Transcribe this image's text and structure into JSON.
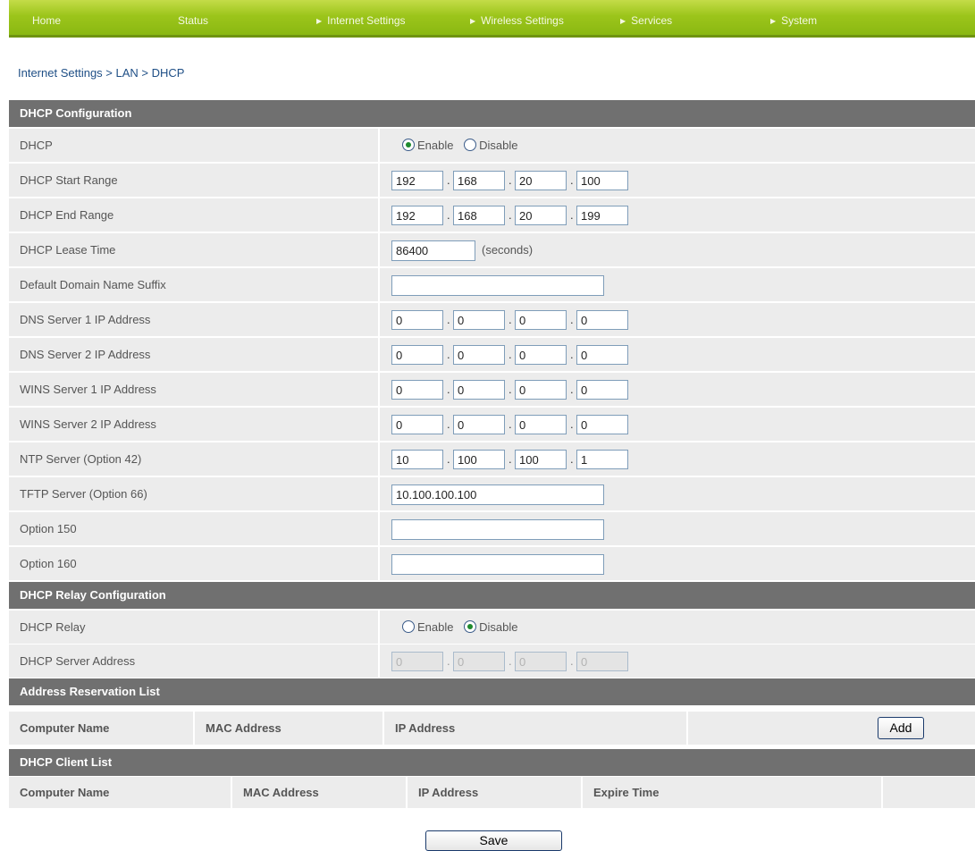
{
  "nav": {
    "items": [
      {
        "label": "Home",
        "arrow": false
      },
      {
        "label": "Status",
        "arrow": false
      },
      {
        "label": "Internet Settings",
        "arrow": true
      },
      {
        "label": "Wireless Settings",
        "arrow": true
      },
      {
        "label": "Services",
        "arrow": true
      },
      {
        "label": "System",
        "arrow": true
      }
    ]
  },
  "breadcrumb": "Internet Settings > LAN > DHCP",
  "dhcp_config": {
    "header": "DHCP Configuration",
    "dhcp": {
      "label": "DHCP",
      "enable": "Enable",
      "disable": "Disable",
      "selected": "Enable"
    },
    "start_range": {
      "label": "DHCP Start Range",
      "octets": [
        "192",
        "168",
        "20",
        "100"
      ]
    },
    "end_range": {
      "label": "DHCP End Range",
      "octets": [
        "192",
        "168",
        "20",
        "199"
      ]
    },
    "lease_time": {
      "label": "DHCP Lease Time",
      "value": "86400",
      "unit": "(seconds)"
    },
    "domain_suffix": {
      "label": "Default Domain Name Suffix",
      "value": ""
    },
    "dns1": {
      "label": "DNS Server 1 IP Address",
      "octets": [
        "0",
        "0",
        "0",
        "0"
      ]
    },
    "dns2": {
      "label": "DNS Server 2 IP Address",
      "octets": [
        "0",
        "0",
        "0",
        "0"
      ]
    },
    "wins1": {
      "label": "WINS Server 1 IP Address",
      "octets": [
        "0",
        "0",
        "0",
        "0"
      ]
    },
    "wins2": {
      "label": "WINS Server 2 IP Address",
      "octets": [
        "0",
        "0",
        "0",
        "0"
      ]
    },
    "ntp": {
      "label": "NTP Server  (Option 42)",
      "octets": [
        "10",
        "100",
        "100",
        "1"
      ]
    },
    "tftp": {
      "label": "TFTP Server (Option 66)",
      "value": "10.100.100.100"
    },
    "opt150": {
      "label": "Option 150",
      "value": ""
    },
    "opt160": {
      "label": "Option 160",
      "value": ""
    }
  },
  "relay_config": {
    "header": "DHCP Relay Configuration",
    "relay": {
      "label": "DHCP Relay",
      "enable": "Enable",
      "disable": "Disable",
      "selected": "Disable"
    },
    "server_address": {
      "label": "DHCP Server Address",
      "octets": [
        "0",
        "0",
        "0",
        "0"
      ]
    }
  },
  "reservation": {
    "header": "Address Reservation List",
    "columns": [
      "Computer Name",
      "MAC Address",
      "IP Address"
    ],
    "add_label": "Add"
  },
  "client_list": {
    "header": "DHCP Client List",
    "columns": [
      "Computer Name",
      "MAC Address",
      "IP Address",
      "Expire Time"
    ]
  },
  "save_label": "Save",
  "colors": {
    "nav_green": "#9cc51b",
    "header_gray": "#707070",
    "row_bg": "#ececec",
    "breadcrumb_blue": "#1f4f86"
  }
}
